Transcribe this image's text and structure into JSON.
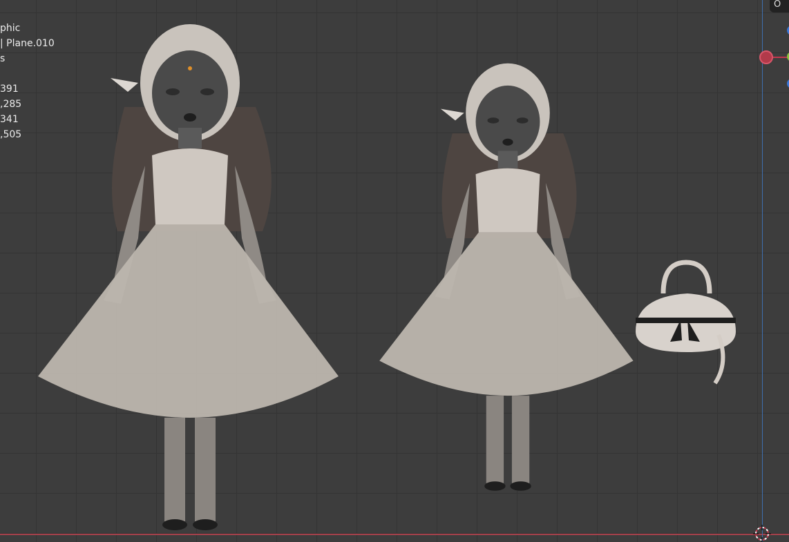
{
  "overlay": {
    "stat_lines": [
      "phic",
      "| Plane.010",
      "s",
      "",
      "391",
      ",285",
      "341",
      ",505"
    ]
  },
  "header": {
    "pill_label": "O"
  },
  "colors": {
    "background": "#3d3d3d",
    "grid": "#343434",
    "x_axis": "#a8414c",
    "z_axis": "#3f6fb0",
    "gizmo_x": "#c5394f",
    "gizmo_y": "#8bc43f",
    "gizmo_z": "#3a76d6",
    "model": "#9a948e"
  },
  "objects": [
    {
      "name": "character-model-left"
    },
    {
      "name": "character-model-right"
    },
    {
      "name": "handbag-model"
    }
  ]
}
